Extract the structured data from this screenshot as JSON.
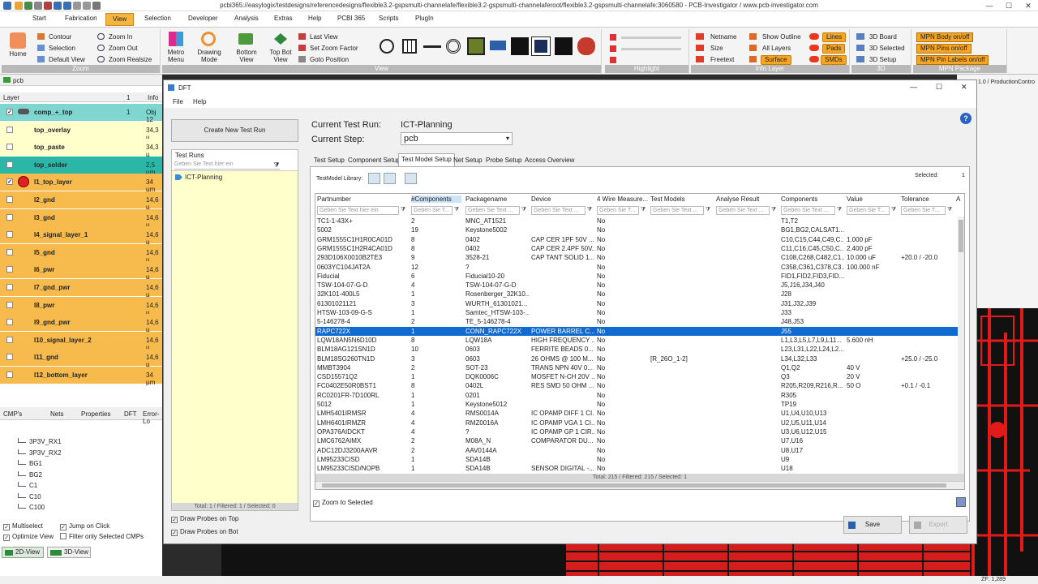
{
  "window": {
    "title": "pcbi365://easylogix/testdesigns/referencedesigns/flexible3.2-gspsmulti-channelafe/flexible3.2-gspsmulti-channelaferoot/flexible3.2-gspsmulti-channelafe:3060580 - PCB-Investigator / www.pcb-investigator.com",
    "minimize": "—",
    "maximize": "☐",
    "close": "✕"
  },
  "menu_tabs": [
    "Start",
    "Fabrication",
    "View",
    "Selection",
    "Developer",
    "Analysis",
    "Extras",
    "Help",
    "PCBI 365",
    "Scripts",
    "PlugIn"
  ],
  "ribbon": {
    "zoom_group": {
      "label": "Zoom",
      "home": "Home",
      "contour": "Contour",
      "selection": "Selection",
      "default_view": "Default View",
      "zoom_in": "Zoom In",
      "zoom_out": "Zoom Out",
      "zoom_realsize": "Zoom Realsize"
    },
    "view_group": {
      "label": "View",
      "metro_menu": "Metro\nMenu",
      "drawing_mode": "Drawing\nMode",
      "bottom_view": "Bottom\nView",
      "top_bot_view": "Top Bot\nView",
      "last_view": "Last View",
      "set_zoom_factor": "Set Zoom Factor",
      "goto_position": "Goto Position"
    },
    "highlight_group": {
      "label": "Highlight"
    },
    "info_layer_group": {
      "label": "Info Layer",
      "netname": "Netname",
      "size": "Size",
      "freetext": "Freetext",
      "show_outline": "Show Outline",
      "all_layers": "All Layers",
      "surface": "Surface",
      "lines": "Lines",
      "pads": "Pads",
      "smds": "SMDs"
    },
    "3d_group": {
      "label": "3D",
      "board": "3D Board",
      "selected": "3D Selected",
      "setup": "3D Setup"
    },
    "mpn_group": {
      "label": "MPN Package",
      "body": "MPN Body on/off",
      "pins": "MPN Pins on/off",
      "pin_labels": "MPN Pin Labels on/off"
    }
  },
  "left_panel": {
    "pcb_tab": "pcb",
    "header": {
      "layer": "Layer",
      "num": "1",
      "info": "Info"
    },
    "layers": [
      {
        "name": "comp_+_top",
        "num": "1",
        "info": "Obj 12",
        "color": "#7fd6d0",
        "checked": true
      },
      {
        "name": "top_overlay",
        "num": "",
        "info": "34,3 µ",
        "color": "#ffffcc",
        "checked": false
      },
      {
        "name": "top_paste",
        "num": "",
        "info": "34,3 µ",
        "color": "#ffffcc",
        "checked": false
      },
      {
        "name": "top_solder",
        "num": "",
        "info": "2,5 µm",
        "color": "#2ab7a8",
        "checked": false
      },
      {
        "name": "l1_top_layer",
        "num": "",
        "info": "34 µm",
        "color": "#f6bb4c",
        "checked": true
      },
      {
        "name": "l2_gnd",
        "num": "",
        "info": "14,6 µ",
        "color": "#f6bb4c",
        "checked": false
      },
      {
        "name": "l3_gnd",
        "num": "",
        "info": "14,6 µ",
        "color": "#f6bb4c",
        "checked": false
      },
      {
        "name": "l4_signal_layer_1",
        "num": "",
        "info": "14,6 µ",
        "color": "#f6bb4c",
        "checked": false
      },
      {
        "name": "l5_gnd",
        "num": "",
        "info": "14,6 µ",
        "color": "#f6bb4c",
        "checked": false
      },
      {
        "name": "l6_pwr",
        "num": "",
        "info": "14,6 µ",
        "color": "#f6bb4c",
        "checked": false
      },
      {
        "name": "l7_gnd_pwr",
        "num": "",
        "info": "14,6 µ",
        "color": "#f6bb4c",
        "checked": false
      },
      {
        "name": "l8_pwr",
        "num": "",
        "info": "14,6 µ",
        "color": "#f6bb4c",
        "checked": false
      },
      {
        "name": "l9_gnd_pwr",
        "num": "",
        "info": "14,6 µ",
        "color": "#f6bb4c",
        "checked": false
      },
      {
        "name": "l10_signal_layer_2",
        "num": "",
        "info": "14,6 µ",
        "color": "#f6bb4c",
        "checked": false
      },
      {
        "name": "l11_gnd",
        "num": "",
        "info": "14,6 µ",
        "color": "#f6bb4c",
        "checked": false
      },
      {
        "name": "l12_bottom_layer",
        "num": "",
        "info": "34 µm",
        "color": "#f6bb4c",
        "checked": false
      }
    ],
    "bottom_tabs": [
      "CMP's",
      "Nets",
      "Properties",
      "DFT",
      "Error-Lo"
    ],
    "cmp_items": [
      "3P3V_RX1",
      "3P3V_RX2",
      "BG1",
      "BG2",
      "C1",
      "C10",
      "C100"
    ],
    "options": {
      "multiselect": "Multiselect",
      "jump_on_click": "Jump on Click",
      "optimize_view": "Optimize View",
      "filter_only_selected": "Filter only Selected CMPs"
    },
    "view_buttons": {
      "view2d": "2D-View",
      "view3d": "3D-View"
    }
  },
  "behind_label": "1.0 / ProductionContro",
  "dft": {
    "title": "DFT",
    "menu": [
      "File",
      "Help"
    ],
    "create_button": "Create New Test Run",
    "runs_title": "Test Runs",
    "runs_filter_placeholder": "Geben Sie Text hier ein",
    "runs": [
      "ICT-Planning"
    ],
    "runs_footer": "Total: 1 / Filtered: 1 / Selected: 0",
    "current_run_label": "Current Test Run:",
    "current_run_value": "ICT-Planning",
    "current_step_label": "Current Step:",
    "current_step_value": "pcb",
    "tabs": [
      "Test Setup",
      "Component Setup",
      "Test Model Setup",
      "Net Setup",
      "Probe Setup",
      "Access Overview"
    ],
    "active_tab": "Test Model Setup",
    "library_label": "TestModel Library:",
    "selected_label": "Selected:",
    "selected_value": "1",
    "columns": [
      "Partnumber",
      "#Components",
      "Packagename",
      "Device",
      "4 Wire Measure...",
      "Test Models",
      "Analyse Result",
      "Components",
      "Value",
      "Tolerance",
      "A"
    ],
    "filter_placeholder": "Geben Sie Text hier ein",
    "filter_placeholder_short": "Geben Sie Text ...",
    "filter_placeholder_tiny": "Geben Sie T...",
    "rows": [
      [
        "TC1-1-43X+",
        "2",
        "MNC_AT1521",
        "",
        "No",
        "",
        "",
        "T1,T2",
        "",
        ""
      ],
      [
        "5002",
        "19",
        "Keystone5002",
        "",
        "No",
        "",
        "",
        "BG1,BG2,CALSAT1...",
        "",
        ""
      ],
      [
        "GRM1555C1H1R0CA01D",
        "8",
        "0402",
        "CAP CER 1PF 50V ...",
        "No",
        "",
        "",
        "C10,C15,C44,C49,C...",
        "1.000 pF",
        ""
      ],
      [
        "GRM1555C1H2R4CA01D",
        "8",
        "0402",
        "CAP CER 2.4PF 50V...",
        "No",
        "",
        "",
        "C11,C16,C45,C50,C...",
        "2.400 pF",
        ""
      ],
      [
        "293D106X0010B2TE3",
        "9",
        "3528-21",
        "CAP TANT SOLID 1...",
        "No",
        "",
        "",
        "C108,C268,C482,C1...",
        "10.000 uF",
        "+20.0 / -20.0"
      ],
      [
        "0603YC104JAT2A",
        "12",
        "?",
        "",
        "No",
        "",
        "",
        "C358,C361,C378,C3...",
        "100.000 nF",
        ""
      ],
      [
        "Fiducial",
        "6",
        "Fiducial10-20",
        "",
        "No",
        "",
        "",
        "FID1,FID2,FID3,FID...",
        "",
        ""
      ],
      [
        "TSW-104-07-G-D",
        "4",
        "TSW-104-07-G-D",
        "",
        "No",
        "",
        "",
        "J5,J16,J34,J40",
        "",
        ""
      ],
      [
        "32K101-400L5",
        "1",
        "Rosenberger_32K10...",
        "",
        "No",
        "",
        "",
        "J28",
        "",
        ""
      ],
      [
        "61301021121",
        "3",
        "WURTH_61301021...",
        "",
        "No",
        "",
        "",
        "J31,J32,J39",
        "",
        ""
      ],
      [
        "HTSW-103-09-G-S",
        "1",
        "Samtec_HTSW-103-...",
        "",
        "No",
        "",
        "",
        "J33",
        "",
        ""
      ],
      [
        "5-146278-4",
        "2",
        "TE_5-146278-4",
        "",
        "No",
        "",
        "",
        "J48,J53",
        "",
        ""
      ],
      [
        "RAPC722X",
        "1",
        "CONN_RAPC722X",
        "POWER BARREL C...",
        "No",
        "",
        "",
        "J55",
        "",
        ""
      ],
      [
        "LQW18AN5N6D10D",
        "8",
        "LQW18A",
        "HIGH FREQUENCY ...",
        "No",
        "",
        "",
        "L1,L3,L5,L7,L9,L11...",
        "5.600 nH",
        ""
      ],
      [
        "BLM18AG121SN1D",
        "10",
        "0603",
        "FERRITE BEADS 0...",
        "No",
        "",
        "",
        "L23,L31,L22,L24,L2...",
        "",
        ""
      ],
      [
        "BLM18SG260TN1D",
        "3",
        "0603",
        "26 OHMS @ 100 M...",
        "No",
        "[R_26O_1-2]",
        "",
        "L34,L32,L33",
        "",
        "+25.0 / -25.0"
      ],
      [
        "MMBT3904",
        "2",
        "SOT-23",
        "TRANS NPN 40V 0...",
        "No",
        "",
        "",
        "Q1,Q2",
        "40 V",
        ""
      ],
      [
        "CSD15571Q2",
        "1",
        "DQK0006C",
        "MOSFET N-CH 20V ...",
        "No",
        "",
        "",
        "Q3",
        "20 V",
        ""
      ],
      [
        "FC0402E50R0BST1",
        "8",
        "0402L",
        "RES SMD 50 OHM ...",
        "No",
        "",
        "",
        "R205,R209,R216,R...",
        "50 O",
        "+0.1 / -0.1"
      ],
      [
        "RC0201FR-7D100RL",
        "1",
        "0201",
        "",
        "No",
        "",
        "",
        "R305",
        "",
        ""
      ],
      [
        "5012",
        "1",
        "Keystone5012",
        "",
        "No",
        "",
        "",
        "TP19",
        "",
        ""
      ],
      [
        "LMH5401IRMSR",
        "4",
        "RMS0014A",
        "IC OPAMP DIFF 1 CI...",
        "No",
        "",
        "",
        "U1,U4,U10,U13",
        "",
        ""
      ],
      [
        "LMH6401IRMZR",
        "4",
        "RMZ0016A",
        "IC OPAMP VGA 1 CI...",
        "No",
        "",
        "",
        "U2,U5,U11,U14",
        "",
        ""
      ],
      [
        "OPA376AIDCKT",
        "4",
        "?",
        "IC OPAMP GP 1 CIR...",
        "No",
        "",
        "",
        "U3,U6,U12,U15",
        "",
        ""
      ],
      [
        "LMC6762AIMX",
        "2",
        "M08A_N",
        "COMPARATOR DU...",
        "No",
        "",
        "",
        "U7,U16",
        "",
        ""
      ],
      [
        "ADC12DJ3200AAVR",
        "2",
        "AAV0144A",
        "",
        "No",
        "",
        "",
        "U8,U17",
        "",
        ""
      ],
      [
        "LM95233CISD",
        "1",
        "SDA14B",
        "",
        "No",
        "",
        "",
        "U9",
        "",
        ""
      ],
      [
        "LM95233CISD/NOPB",
        "1",
        "SDA14B",
        "SENSOR DIGITAL -...",
        "No",
        "",
        "",
        "U18",
        "",
        ""
      ]
    ],
    "selected_row": 12,
    "grid_footer": "Total: 215 / Filtered: 215 / Selected: 1",
    "zoom_to_selected": "Zoom to Selected",
    "draw_probes_top": "Draw Probes on Top",
    "draw_probes_bot": "Draw Probes on Bot",
    "save": "Save",
    "export": "Export",
    "help_icon": "?"
  },
  "status": {
    "zf": "ZF: 1,289"
  },
  "colors": {
    "accent_orange": "#f5b541",
    "selection_blue": "#0f6bd1",
    "pcb_red": "#d41d1d"
  }
}
